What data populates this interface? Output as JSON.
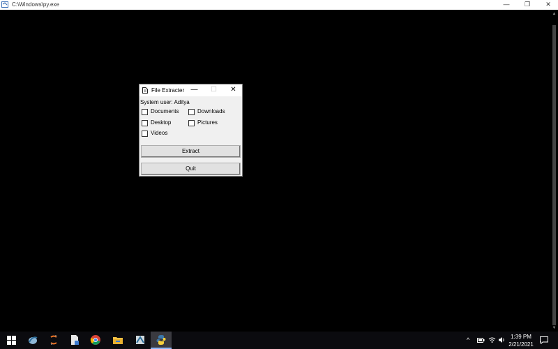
{
  "console": {
    "title": "C:\\Windows\\py.exe",
    "controls": {
      "minimize": "—",
      "restore": "❐",
      "close": "✕"
    }
  },
  "dialog": {
    "title": "File Extracter",
    "controls": {
      "minimize": "—",
      "maximize": "☐",
      "close": "✕"
    },
    "user_label": "System user: Aditya",
    "checkboxes": [
      {
        "label": "Documents",
        "checked": false
      },
      {
        "label": "Downloads",
        "checked": false
      },
      {
        "label": "Desktop",
        "checked": false
      },
      {
        "label": "Pictures",
        "checked": false
      },
      {
        "label": "Videos",
        "checked": false
      }
    ],
    "extract_label": "Extract",
    "quit_label": "Quit"
  },
  "taskbar": {
    "apps": [
      {
        "name": "start-icon"
      },
      {
        "name": "program-icon-1"
      },
      {
        "name": "program-icon-2"
      },
      {
        "name": "document-icon"
      },
      {
        "name": "chrome-icon"
      },
      {
        "name": "file-explorer-icon"
      },
      {
        "name": "program-icon-3"
      },
      {
        "name": "python-icon"
      }
    ],
    "tray": {
      "chevron": "^",
      "time": "1:39 PM",
      "date": "2/21/2021"
    }
  },
  "colors": {
    "accent": "#8ab4f8",
    "taskbar": "#0b0b0f",
    "dialog_bg": "#f0f0f0"
  }
}
